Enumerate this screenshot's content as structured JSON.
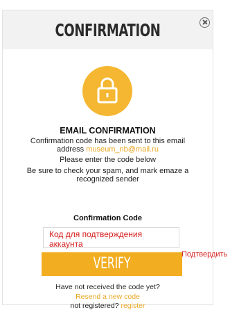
{
  "dialog": {
    "title": "CONFIRMATION",
    "close_icon": "close-circle-icon",
    "lock_icon": "lock-icon",
    "accent_color": "#f5b731"
  },
  "email_section": {
    "heading": "EMAIL CONFIRMATION",
    "line1": "Confirmation code has been sent to this email",
    "line2_prefix": "address ",
    "email": "museum_nb@mail.ru",
    "line3": "Please enter the code below",
    "line4": "Be sure to check your spam, and mark emaze a",
    "line5": "recognized sender"
  },
  "form": {
    "code_label": "Confirmation Code",
    "code_input_annotation": "Код для подтверждения аккаунта",
    "verify_label": "VERIFY",
    "verify_annotation": "Подтвердить"
  },
  "footer": {
    "not_received": "Have not received the code yet?",
    "resend_link": "Resend a new code",
    "not_registered": "not registered?",
    "register_link": "register"
  }
}
